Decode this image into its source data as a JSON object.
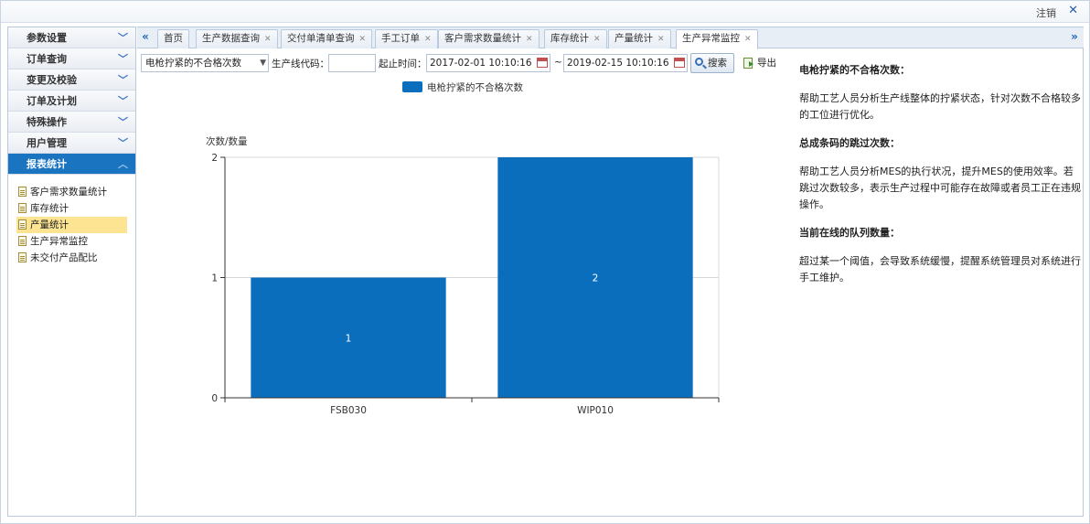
{
  "topbar": {
    "logout_label": "注销",
    "close_glyph": "✕"
  },
  "sidebar": {
    "sections": [
      {
        "label": "参数设置",
        "active": false
      },
      {
        "label": "订单查询",
        "active": false
      },
      {
        "label": "变更及校验",
        "active": false
      },
      {
        "label": "订单及计划",
        "active": false
      },
      {
        "label": "特殊操作",
        "active": false
      },
      {
        "label": "用户管理",
        "active": false
      },
      {
        "label": "报表统计",
        "active": true
      }
    ],
    "items": [
      {
        "label": "客户需求数量统计"
      },
      {
        "label": "库存统计"
      },
      {
        "label": "产量统计"
      },
      {
        "label": "生产异常监控"
      },
      {
        "label": "未交付产品配比"
      }
    ],
    "selected_item": "产量统计"
  },
  "tabs": [
    {
      "label": "首页",
      "closable": false
    },
    {
      "label": "生产数据查询",
      "closable": true
    },
    {
      "label": "交付单清单查询",
      "closable": true
    },
    {
      "label": "手工订单",
      "closable": true
    },
    {
      "label": "客户需求数量统计",
      "closable": true
    },
    {
      "label": "库存统计",
      "closable": true
    },
    {
      "label": "产量统计",
      "closable": true
    },
    {
      "label": "生产异常监控",
      "closable": true,
      "active": true
    }
  ],
  "toolbar": {
    "metric_select": "电枪拧紧的不合格次数",
    "line_code_label": "生产线代码：",
    "line_code_value": "",
    "time_label": "起止时间：",
    "start_time": "2017-02-01 10:10:16",
    "tilde": "~",
    "end_time": "2019-02-15 10:10:16",
    "search_label": "搜索",
    "export_label": "导出"
  },
  "chart_data": {
    "type": "bar",
    "categories": [
      "FSB030",
      "WIP010"
    ],
    "series": [
      {
        "name": "电枪拧紧的不合格次数",
        "values": [
          1,
          2
        ],
        "color": "#0a6ebd"
      }
    ],
    "ylabel": "次数/数量",
    "ylim": [
      0,
      2
    ],
    "yticks": [
      0,
      1,
      2
    ],
    "grid": true,
    "legend": "top-center"
  },
  "info": [
    {
      "title": "电枪拧紧的不合格次数：",
      "text": "帮助工艺人员分析生产线整体的拧紧状态，针对次数不合格较多的工位进行优化。"
    },
    {
      "title": "总成条码的跳过次数：",
      "text": "帮助工艺人员分析MES的执行状况，提升MES的使用效率。若跳过次数较多，表示生产过程中可能存在故障或者员工正在违规操作。"
    },
    {
      "title": "当前在线的队列数量：",
      "text": "超过某一个阈值，会导致系统缓慢，提醒系统管理员对系统进行手工维护。"
    }
  ]
}
